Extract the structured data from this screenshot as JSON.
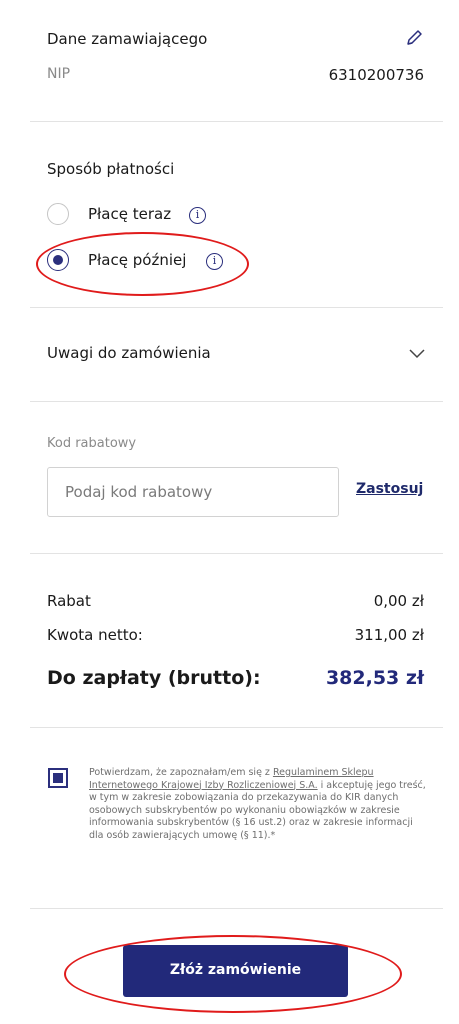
{
  "orderer": {
    "title": "Dane zamawiającego",
    "nip_label": "NIP",
    "nip_value": "6310200736",
    "edit_icon": "pencil-icon"
  },
  "payment": {
    "title": "Sposób płatności",
    "options": [
      {
        "label": "Płacę teraz",
        "selected": false
      },
      {
        "label": "Płacę później",
        "selected": true
      }
    ],
    "info_glyph": "i"
  },
  "notes": {
    "title": "Uwagi do zamówienia",
    "icon": "chevron-down-icon"
  },
  "discount": {
    "label": "Kod rabatowy",
    "placeholder": "Podaj kod rabatowy",
    "value": "",
    "apply_label": "Zastosuj"
  },
  "summary": {
    "discount_label": "Rabat",
    "discount_value": "0,00 zł",
    "net_label": "Kwota netto:",
    "net_value": "311,00 zł",
    "gross_label": "Do zapłaty (brutto):",
    "gross_value": "382,53 zł"
  },
  "consent": {
    "checked": true,
    "text_before": "Potwierdzam, że zapoznałam/em się z ",
    "link_text": "Regulaminem Sklepu Internetowego Krajowej Izby Rozliczeniowej S.A.",
    "text_after": " i akceptuję jego treść, w tym w zakresie zobowiązania do przekazywania do KIR danych osobowych subskrybentów po wykonaniu obowiązków w zakresie informowania subskrybentów (§ 16 ust.2) oraz w zakresie informacji dla osób zawierających umowę (§ 11).*"
  },
  "submit": {
    "label": "Złóż zamówienie"
  },
  "colors": {
    "accent": "#22297a",
    "annotation": "#e01b1b"
  }
}
